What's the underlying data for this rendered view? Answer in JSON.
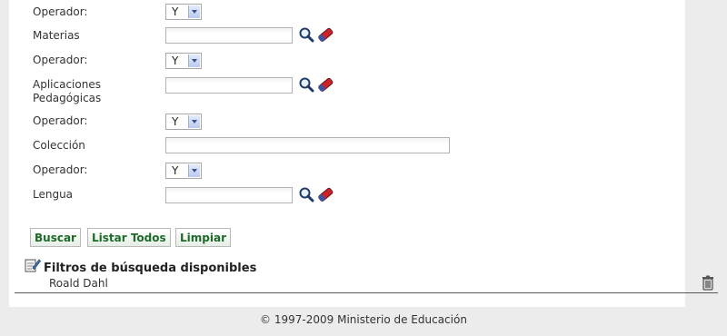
{
  "form": {
    "rows": [
      {
        "type": "operator",
        "label": "Operador:",
        "value": "Y"
      },
      {
        "type": "lookup",
        "label": "Materias",
        "value": ""
      },
      {
        "type": "operator",
        "label": "Operador:",
        "value": "Y"
      },
      {
        "type": "lookup",
        "label": "Aplicaciones Pedagógicas",
        "value": ""
      },
      {
        "type": "operator",
        "label": "Operador:",
        "value": "Y"
      },
      {
        "type": "text",
        "label": "Colección",
        "value": ""
      },
      {
        "type": "operator",
        "label": "Operador:",
        "value": "Y"
      },
      {
        "type": "lookup",
        "label": "Lengua",
        "value": ""
      }
    ]
  },
  "buttons": {
    "search": "Buscar",
    "list_all": "Listar Todos",
    "clear": "Limpiar"
  },
  "filters": {
    "title": "Filtros de búsqueda disponibles",
    "items": [
      "Roald Dahl"
    ]
  },
  "footer": "© 1997-2009 Ministerio de Educación",
  "icons": {
    "lookup": "magnifier-icon",
    "eraser": "eraser-icon",
    "filter": "filter-edit-icon",
    "delete": "trash-icon"
  }
}
